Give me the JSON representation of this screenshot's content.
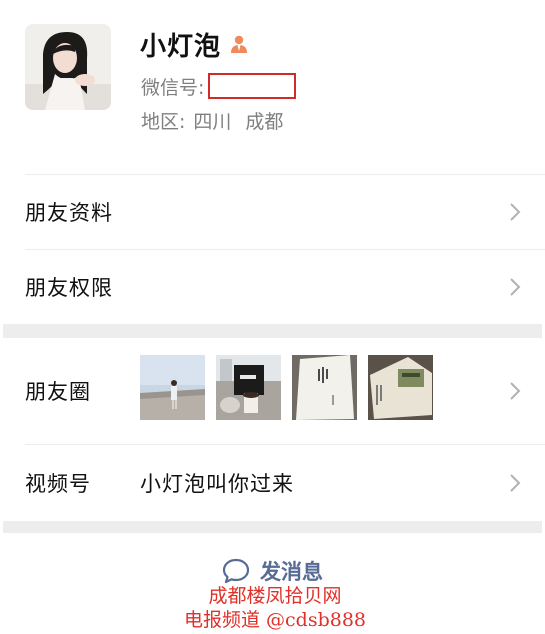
{
  "profile": {
    "name": "小灯泡",
    "wechat_id_label": "微信号:",
    "region_label": "地区:",
    "region_province": "四川",
    "region_city": "成都"
  },
  "rows": {
    "friend_profile": "朋友资料",
    "friend_permissions": "朋友权限",
    "moments": "朋友圈",
    "channels_label": "视频号",
    "channels_value": "小灯泡叫你过来"
  },
  "actions": {
    "send_message": "发消息"
  },
  "watermark": {
    "line1": "成都楼凤拾贝网",
    "line2": "电报频道 @cdsb888"
  },
  "icons": {
    "gender": "male-icon",
    "chevron": "chevron-right-icon",
    "message": "chat-bubble-icon"
  },
  "colors": {
    "link_blue": "#576b95",
    "gender_orange": "#f08a5d",
    "redaction_red": "#d22a2a",
    "watermark_red": "#e0302a",
    "section_gap": "#ededed"
  }
}
